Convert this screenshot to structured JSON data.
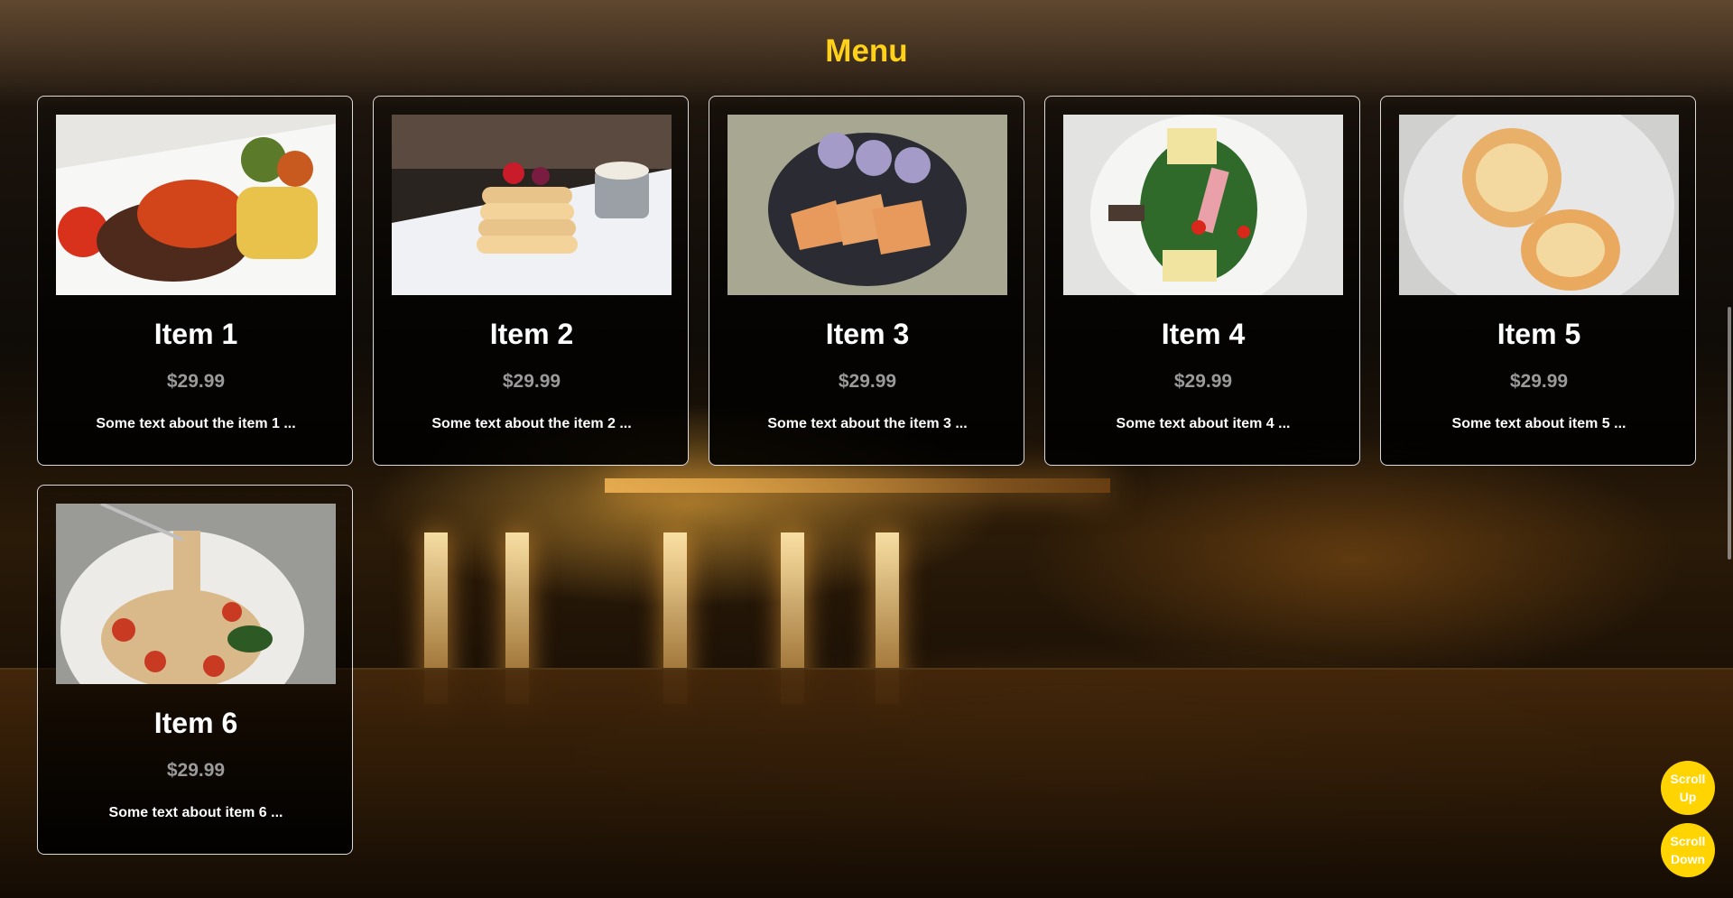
{
  "page": {
    "title": "Menu"
  },
  "items": [
    {
      "title": "Item 1",
      "price": "$29.99",
      "desc": "Some text about the item 1 ..."
    },
    {
      "title": "Item 2",
      "price": "$29.99",
      "desc": "Some text about the item 2 ..."
    },
    {
      "title": "Item 3",
      "price": "$29.99",
      "desc": "Some text about the item 3 ..."
    },
    {
      "title": "Item 4",
      "price": "$29.99",
      "desc": "Some text about item 4 ..."
    },
    {
      "title": "Item 5",
      "price": "$29.99",
      "desc": "Some text about item 5 ..."
    },
    {
      "title": "Item 6",
      "price": "$29.99",
      "desc": "Some text about item 6 ..."
    }
  ],
  "controls": {
    "scroll_up": "Scroll Up",
    "scroll_down": "Scroll Down"
  },
  "colors": {
    "accent": "#ffd119",
    "price": "#9a9a9a",
    "button": "#ffd400"
  }
}
